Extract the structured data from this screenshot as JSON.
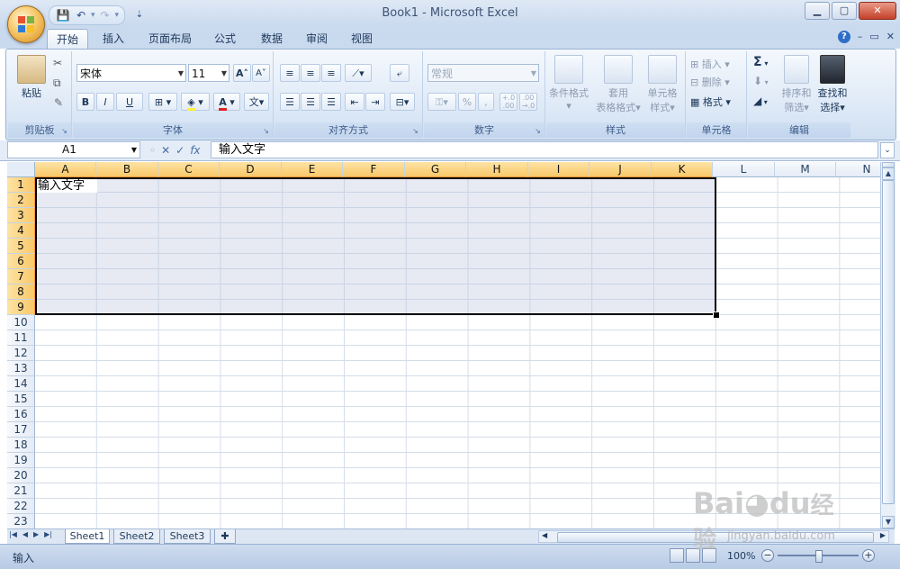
{
  "window": {
    "title": "Book1 - Microsoft Excel"
  },
  "qat": {
    "save": "💾",
    "undo": "↶",
    "redo": "↷",
    "more": "⇣"
  },
  "tabs": [
    "开始",
    "插入",
    "页面布局",
    "公式",
    "数据",
    "审阅",
    "视图"
  ],
  "ribbon": {
    "clipboard": {
      "label": "剪贴板",
      "paste": "粘贴"
    },
    "font": {
      "label": "字体",
      "font_name": "宋体",
      "font_size": "11",
      "bold": "B",
      "italic": "I",
      "underline": "U",
      "grow": "A˄",
      "shrink": "A˅"
    },
    "alignment": {
      "label": "对齐方式"
    },
    "number": {
      "label": "数字",
      "format": "常规",
      "percent": "%",
      "comma": ",",
      "inc_decimal": "+.0\n.00",
      "dec_decimal": ".00\n→.0"
    },
    "styles": {
      "label": "样式",
      "conditional": "条件格式",
      "table_l1": "套用",
      "table_l2": "表格格式",
      "cell_l1": "单元格",
      "cell_l2": "样式"
    },
    "cells": {
      "label": "单元格",
      "insert": "插入",
      "delete": "删除",
      "format": "格式"
    },
    "editing": {
      "label": "编辑",
      "sum": "Σ",
      "sort_l1": "排序和",
      "sort_l2": "筛选",
      "find_l1": "查找和",
      "find_l2": "选择"
    }
  },
  "formula_bar": {
    "name_box": "A1",
    "fx": "fx",
    "cancel": "✕",
    "enter": "✓",
    "value": "输入文字"
  },
  "columns": [
    "A",
    "B",
    "C",
    "D",
    "E",
    "F",
    "G",
    "H",
    "I",
    "J",
    "K",
    "L",
    "M",
    "N"
  ],
  "rows": [
    "1",
    "2",
    "3",
    "4",
    "5",
    "6",
    "7",
    "8",
    "9",
    "10",
    "11",
    "12",
    "13",
    "14",
    "15",
    "16",
    "17",
    "18",
    "19",
    "20",
    "21",
    "22",
    "23"
  ],
  "cells": {
    "A1": "输入文字"
  },
  "sheets": [
    "Sheet1",
    "Sheet2",
    "Sheet3"
  ],
  "status": {
    "mode": "输入",
    "zoom": "100%"
  },
  "watermark": {
    "brand": "Bai",
    "brand_cn": "经验",
    "url": "jingyan.baidu.com"
  }
}
